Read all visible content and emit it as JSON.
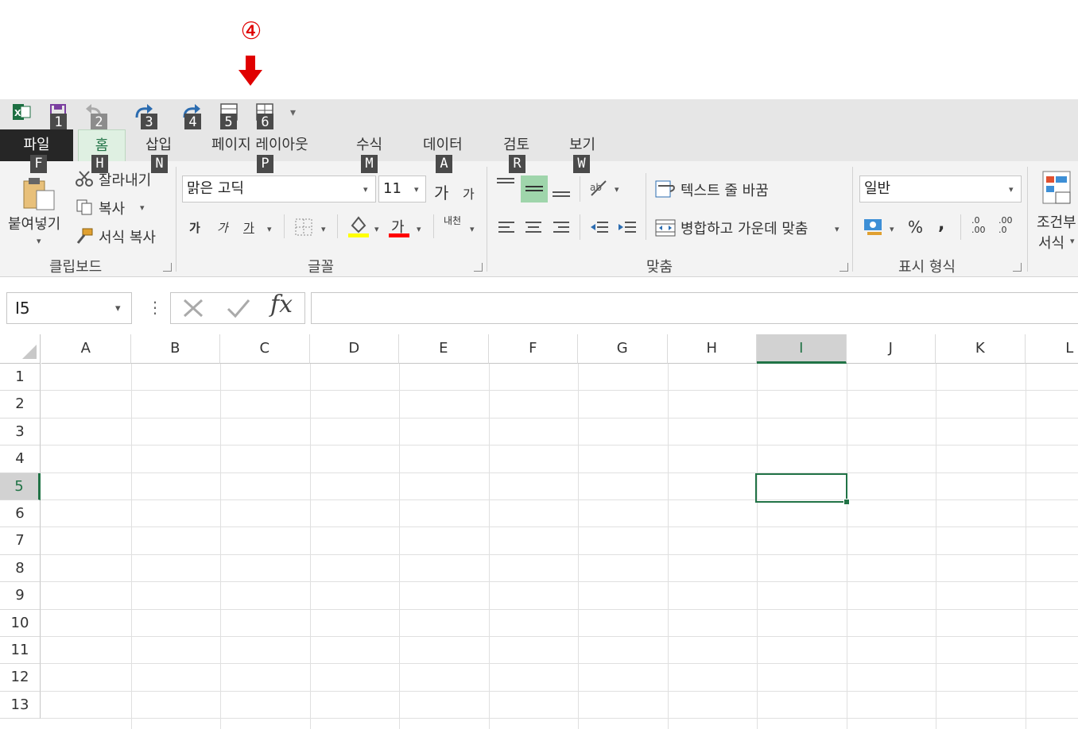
{
  "annotation": {
    "number": "④"
  },
  "quick_access": {
    "key_tips": [
      "1",
      "2",
      "3",
      "4",
      "5",
      "6"
    ],
    "customize": "▾"
  },
  "tabs": [
    {
      "label": "파일",
      "key": "F"
    },
    {
      "label": "홈",
      "key": "H"
    },
    {
      "label": "삽입",
      "key": "N"
    },
    {
      "label": "페이지 레이아웃",
      "key": "P"
    },
    {
      "label": "수식",
      "key": "M"
    },
    {
      "label": "데이터",
      "key": "A"
    },
    {
      "label": "검토",
      "key": "R"
    },
    {
      "label": "보기",
      "key": "W"
    }
  ],
  "clipboard": {
    "paste": "붙여넣기",
    "cut": "잘라내기",
    "copy": "복사",
    "format_painter": "서식 복사",
    "group": "클립보드"
  },
  "font": {
    "name": "맑은 고딕",
    "size": "11",
    "grow": "가",
    "shrink": "가",
    "bold": "가",
    "italic": "가",
    "underline": "가",
    "font_color": "가",
    "phonetic": "내천",
    "group": "글꼴"
  },
  "alignment": {
    "wrap_text": "텍스트 줄 바꿈",
    "merge_center": "병합하고 가운데 맞춤",
    "group": "맞춤"
  },
  "number": {
    "format": "일반",
    "percent": "%",
    "comma": ",",
    "inc_decimal": ".0 .00",
    "dec_decimal": ".00 .0",
    "group": "표시 형식"
  },
  "styles": {
    "conditional": "조건부",
    "format": "서식"
  },
  "formula_bar": {
    "name_box": "I5",
    "fx": "fx",
    "menu_dots": "⋮",
    "value": ""
  },
  "columns": [
    "A",
    "B",
    "C",
    "D",
    "E",
    "F",
    "G",
    "H",
    "I",
    "J",
    "K",
    "L"
  ],
  "rows": [
    "1",
    "2",
    "3",
    "4",
    "5",
    "6",
    "7",
    "8",
    "9",
    "10",
    "11",
    "12",
    "13"
  ],
  "selected_cell": {
    "column": "I",
    "row": "5"
  },
  "colors": {
    "accent_green": "#217346",
    "anno_red": "#e00000",
    "highlight_yellow": "#ffff00",
    "font_red": "#ff0000"
  }
}
